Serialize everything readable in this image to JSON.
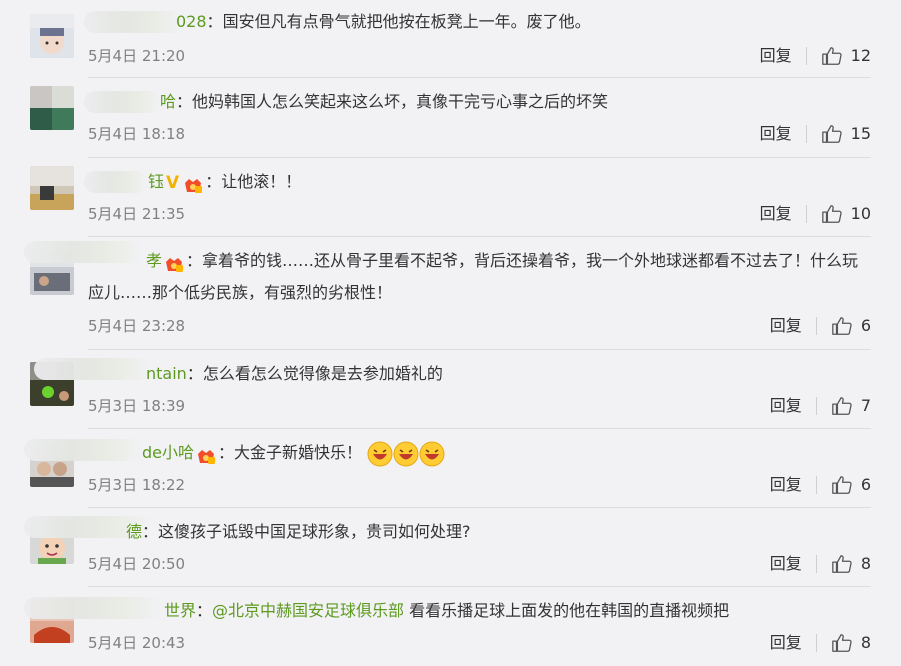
{
  "ui": {
    "reply_label": "回复"
  },
  "comments": [
    {
      "name_tail": "028",
      "text": "国安但凡有点骨气就把他按在板凳上一年。废了他。",
      "time": "5月4日 21:20",
      "likes": "12"
    },
    {
      "name_tail": "哈",
      "text": "他妈韩国人怎么笑起来这么坏，真像干完亏心事之后的坏笑",
      "time": "5月4日 18:18",
      "likes": "15"
    },
    {
      "name_tail": "钰",
      "text": "让他滚！！",
      "time": "5月4日 21:35",
      "likes": "10"
    },
    {
      "name_tail": "孝",
      "text": "拿着爷的钱……还从骨子里看不起爷，背后还操着爷，我一个外地球迷都看不过去了！什么玩应儿……那个低劣民族，有强烈的劣根性！",
      "time": "5月4日 23:28",
      "likes": "6"
    },
    {
      "name_tail": "ntain",
      "text": "怎么看怎么觉得像是去参加婚礼的",
      "time": "5月3日 18:39",
      "likes": "7"
    },
    {
      "name_tail": "de小哈",
      "text": "大金子新婚快乐！",
      "time": "5月3日 18:22",
      "likes": "6"
    },
    {
      "name_tail": "德",
      "text": "这傻孩子诋毁中国足球形象，贵司如何处理?",
      "time": "5月4日 20:50",
      "likes": "8"
    },
    {
      "name_tail": "世界",
      "mention": "@北京中赫国安足球俱乐部",
      "text": "看看乐播足球上面发的他在韩国的直播视频把",
      "time": "5月4日 20:43",
      "likes": "8"
    }
  ]
}
